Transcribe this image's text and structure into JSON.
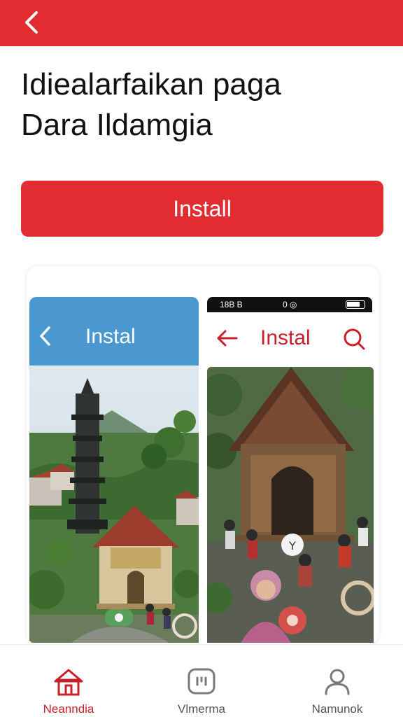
{
  "app_bar": {
    "back_icon": "chevron-left-icon",
    "color": "#e32b32"
  },
  "title": {
    "line1": "Idiealarfaikan paga",
    "line2": "Dara Ildamgia"
  },
  "install_button": {
    "label": "Install",
    "color": "#e32b32"
  },
  "screenshots": {
    "left": {
      "header_title": "Instal",
      "back_icon": "chevron-left-icon",
      "header_color": "#4a98cf"
    },
    "right": {
      "status_time": "18B B",
      "status_right": "0 ◎",
      "header_title": "Instal",
      "back_icon": "arrow-left-icon",
      "search_icon": "search-icon",
      "header_color": "#c8202a"
    }
  },
  "bottom_nav": {
    "items": [
      {
        "label": "Neanndia",
        "icon": "home-icon",
        "active": true
      },
      {
        "label": "Vlmerma",
        "icon": "gallery-icon",
        "active": false
      },
      {
        "label": "Namunok",
        "icon": "profile-icon",
        "active": false
      }
    ]
  }
}
